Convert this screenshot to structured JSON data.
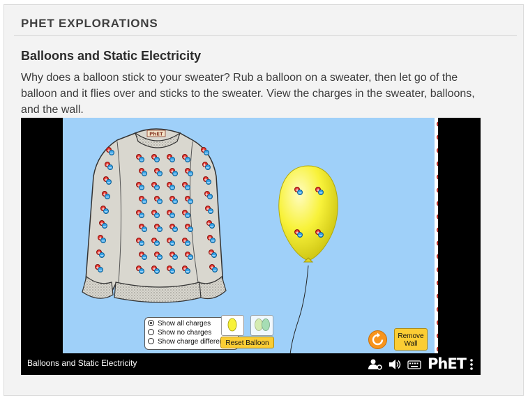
{
  "header": {
    "title": "PHET EXPLORATIONS"
  },
  "sim_info": {
    "title": "Balloons and Static Electricity",
    "description": "Why does a balloon stick to your sweater? Rub a balloon on a sweater, then let go of the balloon and it flies over and sticks to the sweater. View the charges in the sweater, balloons, and the wall."
  },
  "sweater": {
    "logo": "PhET"
  },
  "charge_options": {
    "items": [
      "Show all charges",
      "Show no charges",
      "Show charge differences"
    ],
    "selected_index": 0
  },
  "buttons": {
    "reset_balloon": "Reset Balloon",
    "remove_wall_line1": "Remove",
    "remove_wall_line2": "Wall"
  },
  "bottom_bar": {
    "sim_name": "Balloons and Static Electricity",
    "logo": "PhET",
    "icons": [
      "user-settings-icon",
      "sound-icon",
      "keyboard-icon",
      "more-options-icon"
    ]
  },
  "colors": {
    "play_area": "#9fd0f9",
    "balloon_yellow": "#f8f23a",
    "balloon_green": "#a8e0a8",
    "positive": "#e2312b",
    "negative": "#3aa4e8",
    "button_yellow": "#fbcd34",
    "reset_orange": "#f7941d"
  }
}
